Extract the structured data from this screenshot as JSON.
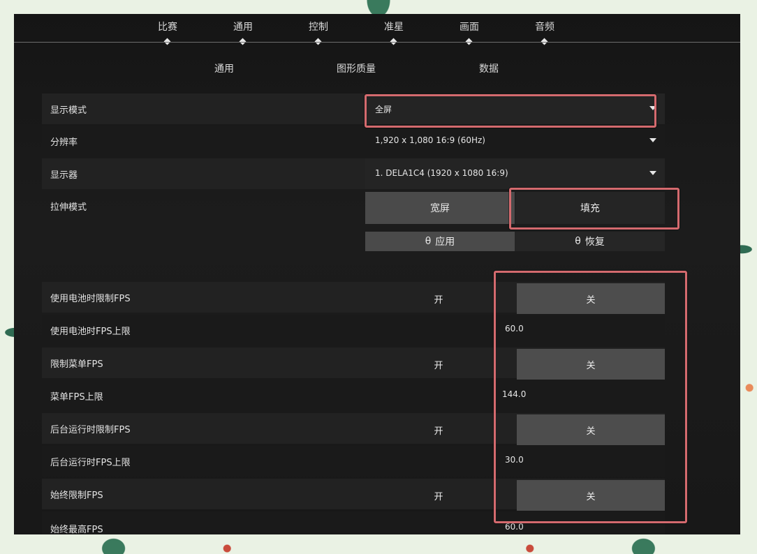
{
  "top_tabs": [
    "比赛",
    "通用",
    "控制",
    "准星",
    "画面",
    "音频"
  ],
  "sub_tabs": [
    "通用",
    "图形质量",
    "数据"
  ],
  "display_mode": {
    "label": "显示模式",
    "value": "全屏"
  },
  "resolution": {
    "label": "分辨率",
    "value": "1,920 x 1,080 16:9 (60Hz)"
  },
  "monitor": {
    "label": "显示器",
    "value": "1. DELA1C4 (1920 x  1080 16:9)"
  },
  "stretch": {
    "label": "拉伸模式",
    "options": [
      "宽屏",
      "填充"
    ],
    "selected": "填充"
  },
  "actions": {
    "apply": "应用",
    "restore": "恢复",
    "icon_glyph": "θ"
  },
  "toggle_labels": {
    "on": "开",
    "off": "关"
  },
  "fps_settings": [
    {
      "label": "使用电池时限制FPS",
      "kind": "toggle",
      "selected": "关"
    },
    {
      "label": "使用电池时FPS上限",
      "kind": "number",
      "value": "60.0"
    },
    {
      "label": "限制菜单FPS",
      "kind": "toggle",
      "selected": "关"
    },
    {
      "label": "菜单FPS上限",
      "kind": "number",
      "value": "144.0"
    },
    {
      "label": "后台运行时限制FPS",
      "kind": "toggle",
      "selected": "关"
    },
    {
      "label": "后台运行时FPS上限",
      "kind": "number",
      "value": "30.0"
    },
    {
      "label": "始终限制FPS",
      "kind": "toggle",
      "selected": "关"
    },
    {
      "label": "始终最高FPS",
      "kind": "number",
      "value": "60.0"
    }
  ],
  "colors": {
    "highlight": "#d46a6e",
    "background": "#1a1a1a",
    "selected_segment": "#4a4a4a"
  }
}
